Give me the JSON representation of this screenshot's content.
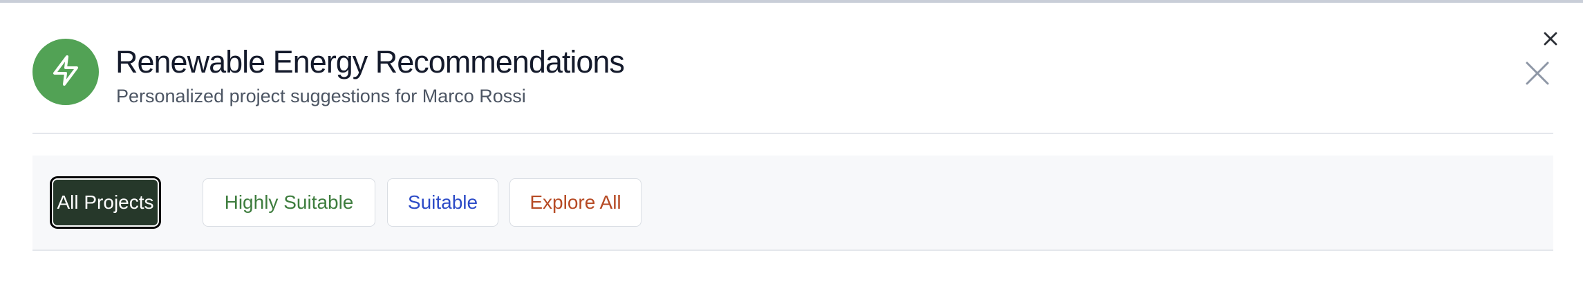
{
  "header": {
    "title": "Renewable Energy Recommendations",
    "subtitle": "Personalized project suggestions for Marco Rossi",
    "icon": "lightning-icon"
  },
  "filters": {
    "all": "All Projects",
    "highly_suitable": "Highly Suitable",
    "suitable": "Suitable",
    "explore": "Explore All",
    "active": "All Projects"
  },
  "colors": {
    "brand_green": "#52a255",
    "active_filter_bg": "#26382a",
    "highly_suitable_text": "#3e7d3e",
    "suitable_text": "#2c4bc7",
    "explore_text": "#b64a24"
  }
}
